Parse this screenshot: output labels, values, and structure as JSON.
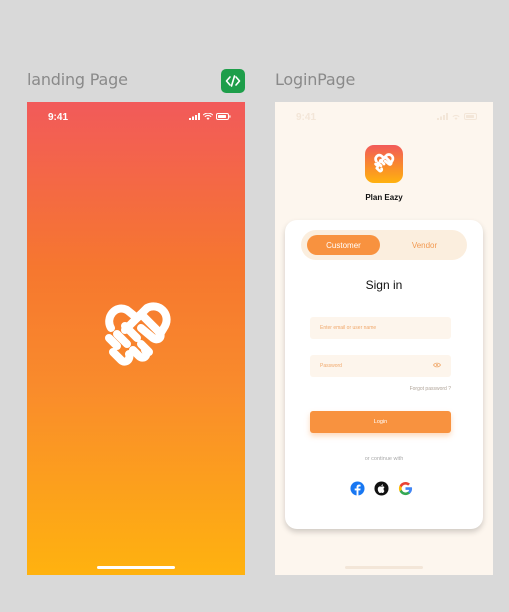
{
  "frames": {
    "landing_label": "landing Page",
    "login_label": "LoginPage"
  },
  "landing": {
    "time": "9:41"
  },
  "login": {
    "time": "9:41",
    "app_name": "Plan Eazy",
    "toggle": {
      "customer": "Customer",
      "vendor": "Vendor"
    },
    "title": "Sign in",
    "email_placeholder": "Enter email or user name",
    "password_placeholder": "Password",
    "forgot": "Forgot password ?",
    "login_button": "Login",
    "continue_text": "or continue with",
    "socials": [
      "facebook-icon",
      "apple-icon",
      "google-icon"
    ]
  },
  "colors": {
    "canvas": "#d9d9d9",
    "accent": "#f8923f",
    "gradient_top": "#f25a5a",
    "gradient_bottom": "#ffb20f",
    "login_bg": "#fdf6ee"
  }
}
